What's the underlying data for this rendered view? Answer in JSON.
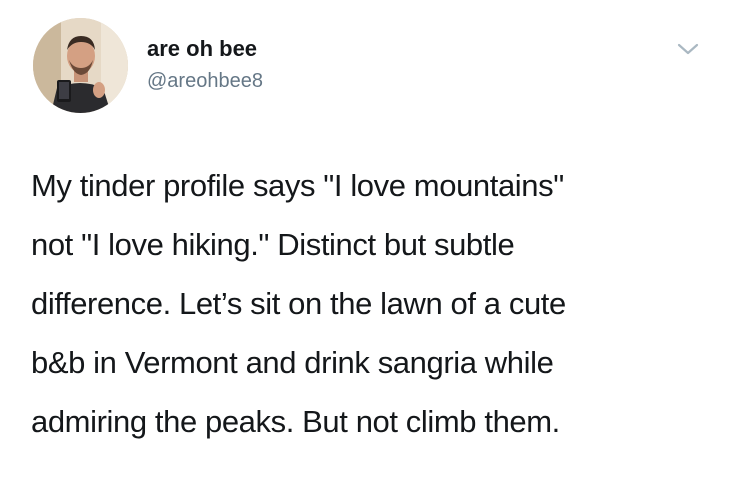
{
  "tweet": {
    "author": {
      "display_name": "are oh bee",
      "handle": "@areohbee8",
      "avatar_icon": "profile-photo"
    },
    "menu_icon": "chevron-down-icon",
    "text_lines": [
      "My tinder profile says \"I love mountains\"",
      "not \"I love hiking.\" Distinct but subtle",
      "difference. Let’s sit on the lawn of a cute",
      "b&b in Vermont and drink sangria while",
      "admiring the peaks. But not climb them."
    ]
  },
  "colors": {
    "background": "#ffffff",
    "text_primary": "#14171a",
    "text_secondary": "#657786",
    "chevron": "#aab8c2"
  }
}
